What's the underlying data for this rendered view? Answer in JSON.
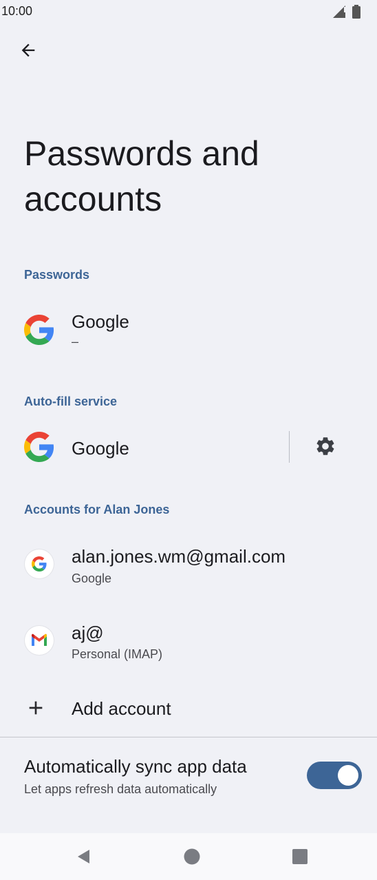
{
  "status_bar": {
    "time": "10:00",
    "signal_icon": "signal-icon",
    "battery_icon": "battery-icon"
  },
  "header": {
    "back_icon": "arrow-back-icon"
  },
  "page_title": "Passwords and accounts",
  "passwords": {
    "section_label": "Passwords",
    "item": {
      "title": "Google",
      "subtitle": "–",
      "icon": "google-icon"
    }
  },
  "autofill": {
    "section_label": "Auto-fill service",
    "item": {
      "title": "Google",
      "icon": "google-icon",
      "settings_icon": "gear-icon"
    }
  },
  "accounts": {
    "section_label": "Accounts for Alan Jones",
    "items": [
      {
        "title": "alan.jones.wm@gmail.com",
        "subtitle": "Google",
        "icon": "google-icon"
      },
      {
        "title": "aj@",
        "subtitle": "Personal (IMAP)",
        "icon": "gmail-icon"
      }
    ],
    "add_label": "Add account"
  },
  "sync": {
    "title": "Automatically sync app data",
    "subtitle": "Let apps refresh data automatically",
    "enabled": true,
    "accent_color": "#3d6596"
  },
  "nav": {
    "back": "triangle-back-icon",
    "home": "circle-home-icon",
    "recents": "square-recents-icon"
  }
}
